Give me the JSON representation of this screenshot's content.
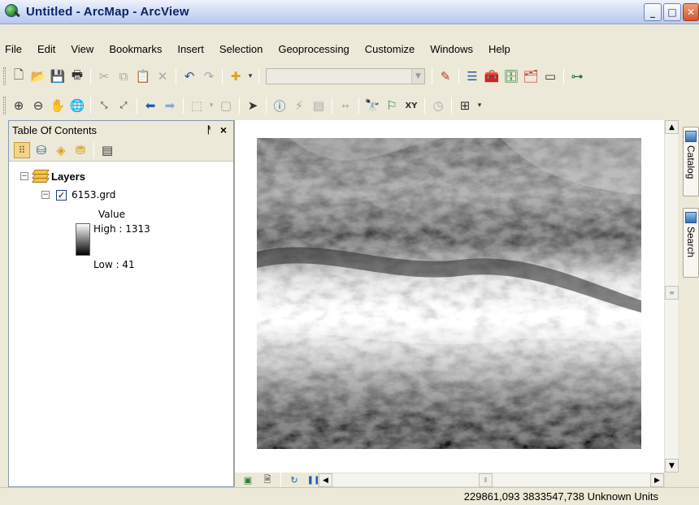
{
  "window": {
    "title": "Untitled - ArcMap - ArcView"
  },
  "menu": [
    "File",
    "Edit",
    "View",
    "Bookmarks",
    "Insert",
    "Selection",
    "Geoprocessing",
    "Customize",
    "Windows",
    "Help"
  ],
  "toc": {
    "title": "Table Of Contents",
    "pin": "I",
    "close": "×",
    "layers_label": "Layers",
    "layer_name": "6153.grd",
    "layer_checked": true,
    "legend": {
      "field": "Value",
      "high": "High : 1313",
      "low": "Low : 41"
    }
  },
  "dock": {
    "catalog": "Catalog",
    "search": "Search"
  },
  "status": {
    "coordinates": "229861,093  3833547,738 Unknown Units"
  },
  "icons": {
    "standard": [
      "new-document-icon",
      "open-icon",
      "save-icon",
      "print-icon",
      "cut-icon",
      "copy-icon",
      "paste-icon",
      "delete-icon",
      "undo-icon",
      "redo-icon",
      "add-data-icon"
    ],
    "tools": [
      "zoom-in-icon",
      "zoom-out-icon",
      "pan-icon",
      "full-extent-icon",
      "fixed-zoom-in-icon",
      "fixed-zoom-out-icon",
      "back-icon",
      "forward-icon",
      "select-features-icon",
      "clear-selection-icon",
      "select-elements-icon",
      "identify-icon",
      "hyperlink-icon",
      "html-popup-icon",
      "measure-icon",
      "find-icon",
      "find-route-icon",
      "go-to-xy-icon",
      "time-slider-icon",
      "create-viewer-window-icon"
    ]
  },
  "colors": {
    "accent": "#0a246a",
    "dem_high": "#ffffff",
    "dem_low": "#000000"
  }
}
